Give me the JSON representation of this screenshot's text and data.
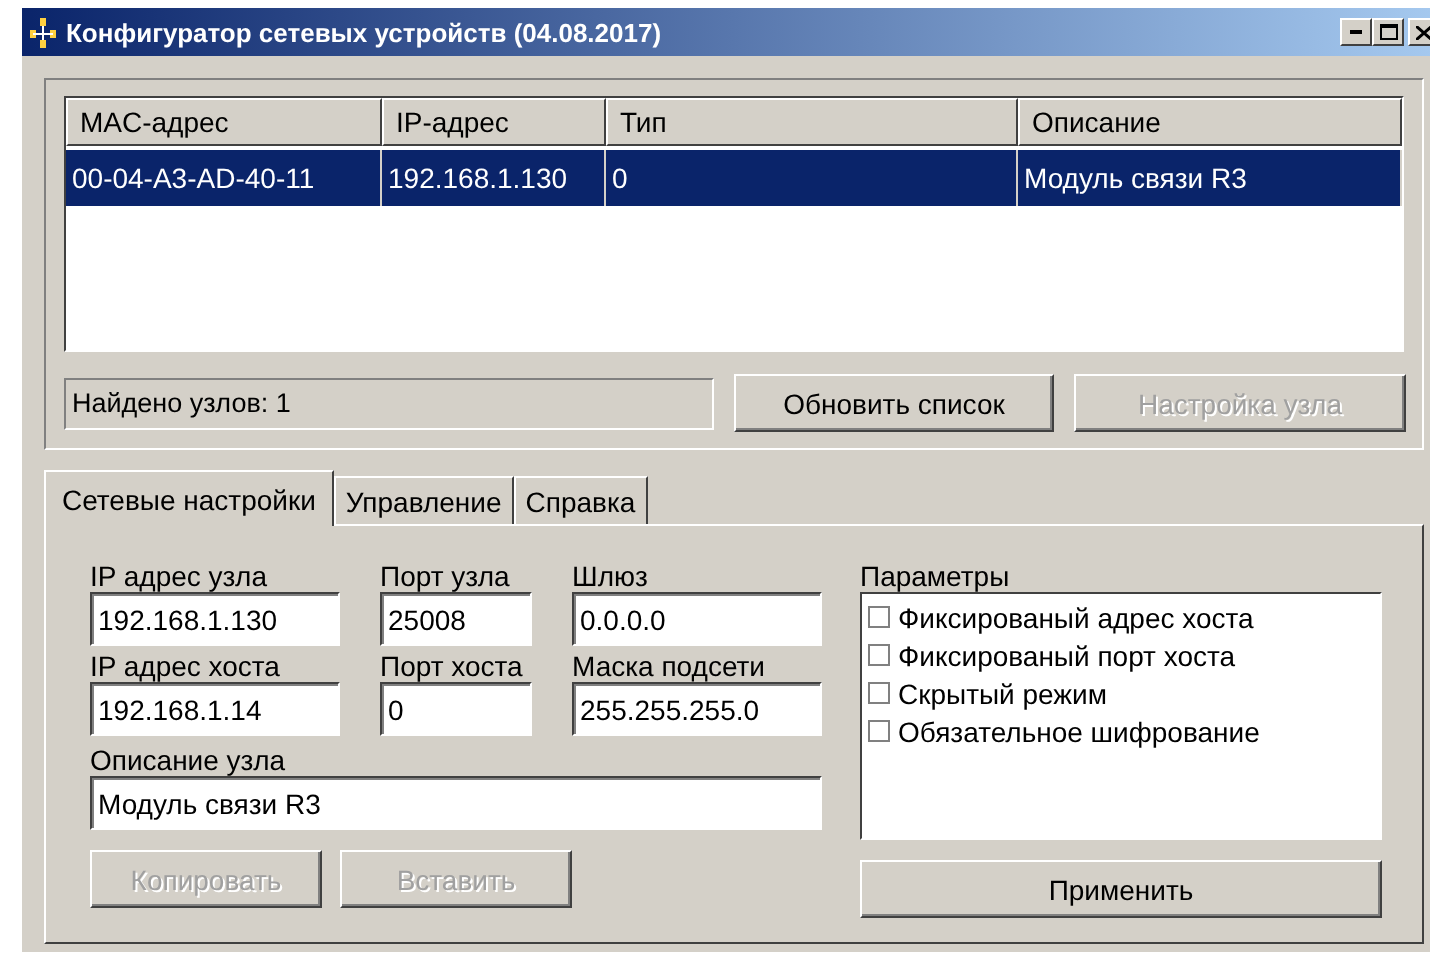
{
  "window": {
    "title": "Конфигуратор сетевых устройств (04.08.2017)"
  },
  "table": {
    "columns": [
      "MAC-адрес",
      "IP-адрес",
      "Тип",
      "Описание"
    ],
    "rows": [
      {
        "cells": [
          "00-04-A3-AD-40-11",
          "192.168.1.130",
          "0",
          "Модуль связи R3"
        ],
        "selected": true
      }
    ]
  },
  "status": "Найдено узлов: 1",
  "list_buttons": [
    {
      "label": "Обновить список",
      "disabled": false
    },
    {
      "label": "Настройка узла",
      "disabled": true
    }
  ],
  "tabs": [
    {
      "label": "Сетевые настройки",
      "selected": true
    },
    {
      "label": "Управление",
      "selected": false
    },
    {
      "label": "Справка",
      "selected": false
    }
  ],
  "fields": [
    {
      "label": "IP адрес узла",
      "value": "192.168.1.130"
    },
    {
      "label": "Порт узла",
      "value": "25008"
    },
    {
      "label": "Шлюз",
      "value": "0.0.0.0"
    },
    {
      "label": "IP адрес хоста",
      "value": "192.168.1.14"
    },
    {
      "label": "Порт хоста",
      "value": "0"
    },
    {
      "label": "Маска подсети",
      "value": "255.255.255.0"
    }
  ],
  "description": {
    "label": "Описание узла",
    "value": "Модуль связи R3"
  },
  "edit_buttons": [
    {
      "label": "Копировать",
      "disabled": true
    },
    {
      "label": "Вставить",
      "disabled": true
    }
  ],
  "parameters": {
    "label": "Параметры",
    "items": [
      {
        "label": "Фиксированый адрес хоста",
        "checked": false
      },
      {
        "label": "Фиксированый порт хоста",
        "checked": false
      },
      {
        "label": "Скрытый режим",
        "checked": false
      },
      {
        "label": "Обязательное шифрование",
        "checked": false
      }
    ]
  },
  "apply_button": {
    "label": "Применить",
    "disabled": false
  }
}
